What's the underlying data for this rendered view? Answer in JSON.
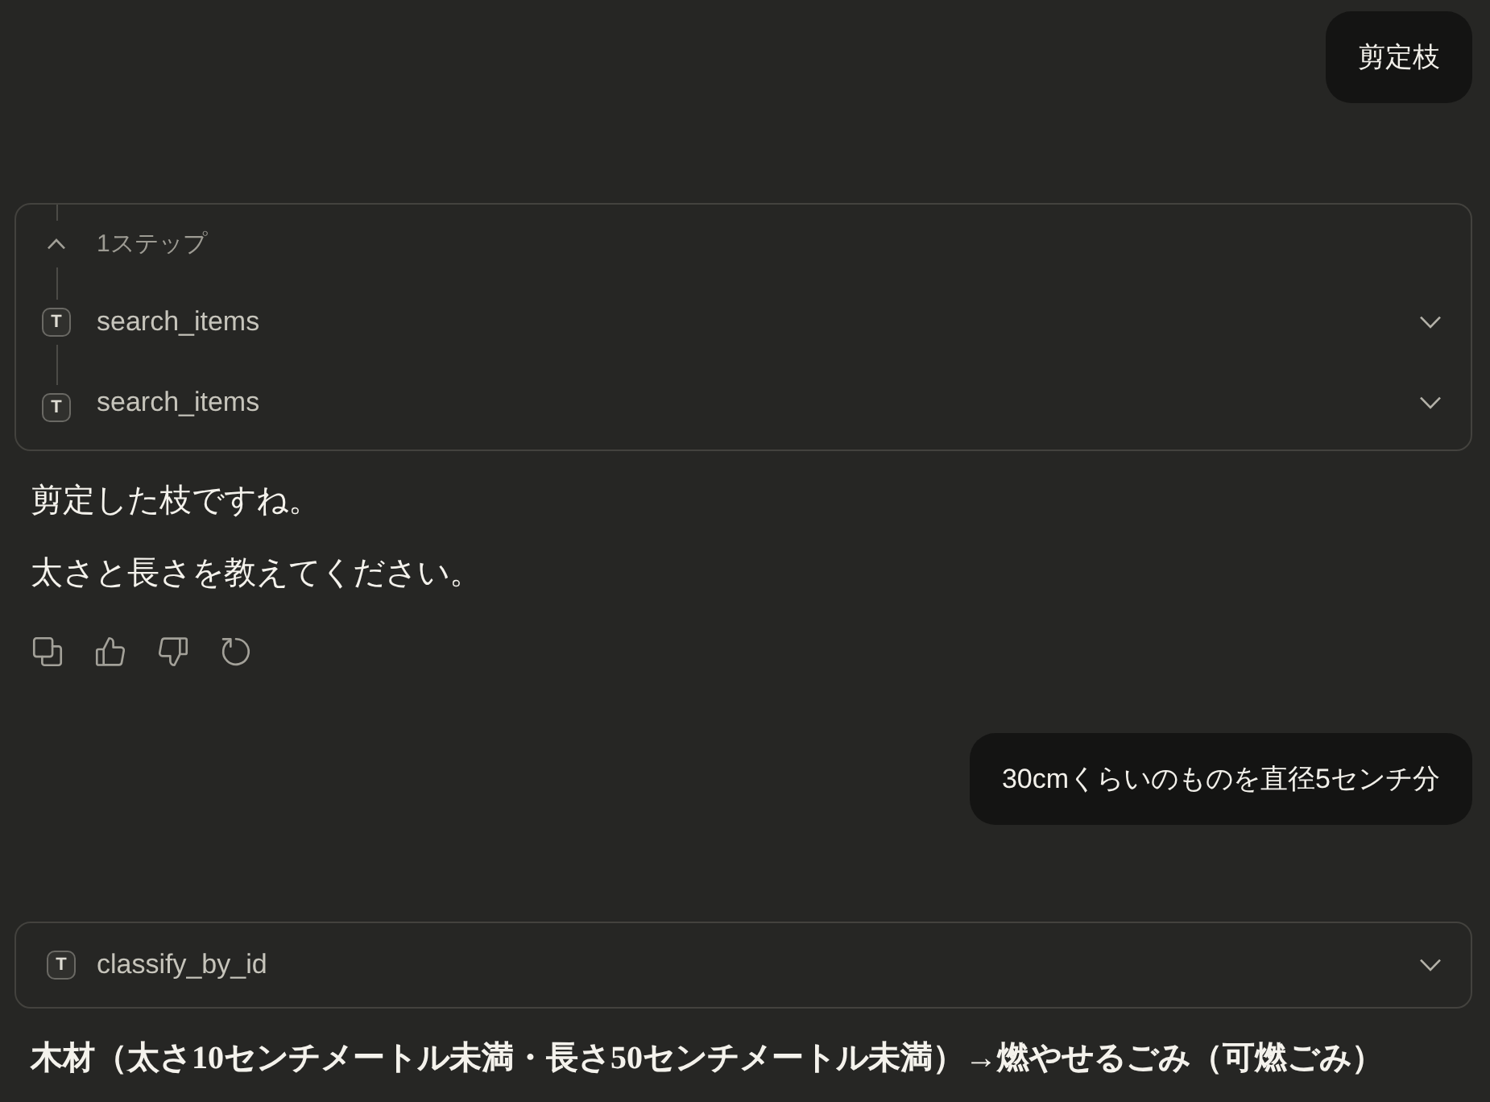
{
  "messages": [
    {
      "kind": "user",
      "text": "剪定枝"
    },
    {
      "kind": "tools",
      "summary": "1ステップ",
      "expanded": true,
      "steps": [
        {
          "badge": "T",
          "name": "search_items",
          "expanded": false
        },
        {
          "badge": "T",
          "name": "search_items",
          "expanded": false
        }
      ]
    },
    {
      "kind": "assistant",
      "paragraphs": [
        {
          "kind": "plain",
          "text": "剪定した枝ですね。"
        },
        {
          "kind": "plain",
          "text": "太さと長さを教えてください。"
        }
      ],
      "actions": true
    },
    {
      "kind": "user",
      "text": "30cmくらいのものを直径5センチ分"
    },
    {
      "kind": "tools",
      "steps": [
        {
          "badge": "T",
          "name": "classify_by_id",
          "expanded": false
        }
      ]
    },
    {
      "kind": "assistant",
      "paragraphs": [
        {
          "kind": "strong",
          "text": "木材（太さ10センチメートル未満・長さ50センチメートル未満）→燃やせるごみ（可燃ごみ）"
        }
      ]
    }
  ]
}
